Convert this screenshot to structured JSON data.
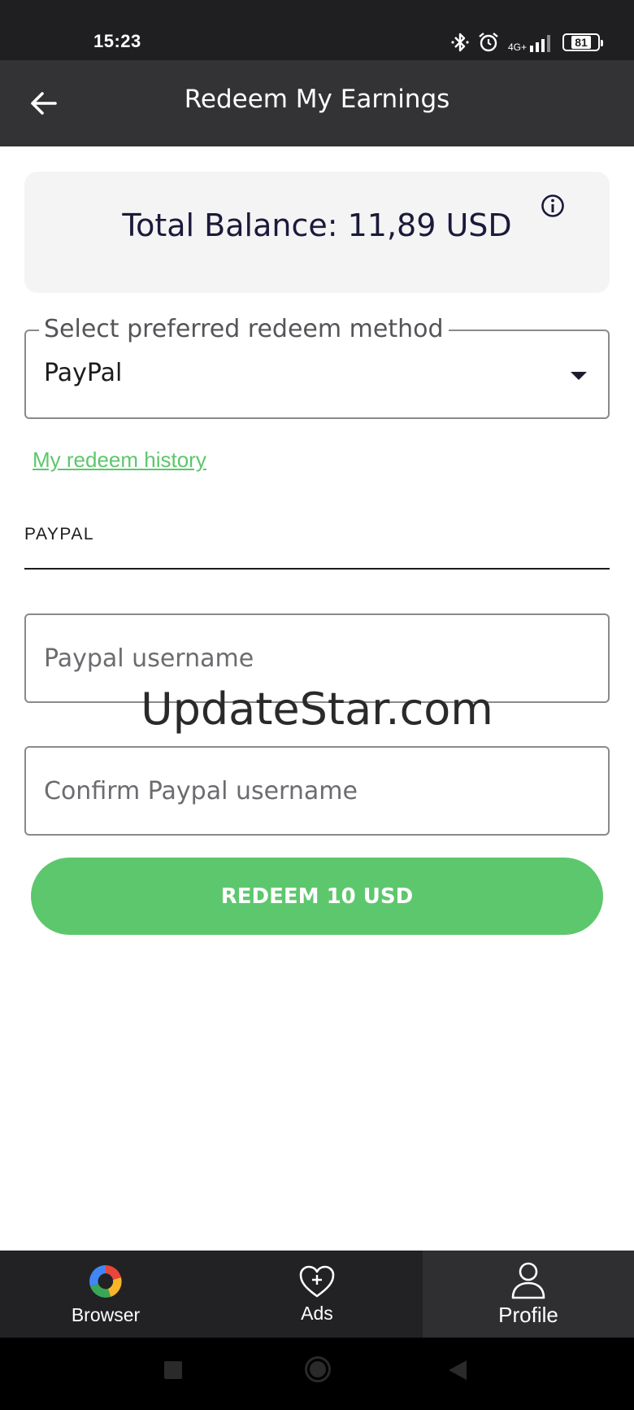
{
  "status_bar": {
    "time": "15:23",
    "network": "4G+",
    "battery": "81",
    "icons": [
      "bluetooth-icon",
      "alarm-icon",
      "signal-icon",
      "battery-icon"
    ]
  },
  "app_bar": {
    "title": "Redeem My Earnings",
    "back_icon": "arrow-left-icon"
  },
  "balance": {
    "text": "Total Balance: 11,89 USD",
    "info_icon": "info-icon"
  },
  "redeem_method": {
    "label": "Select preferred redeem method",
    "value": "PayPal"
  },
  "history_link": "My redeem history",
  "section": {
    "tab_label": "PAYPAL"
  },
  "form": {
    "username_placeholder": "Paypal username",
    "username_value": "",
    "confirm_placeholder": "Confirm Paypal username",
    "confirm_value": "",
    "submit_label": "REDEEM 10 USD"
  },
  "watermark": "UpdateStar.com",
  "bottom_nav": {
    "items": [
      {
        "label": "Browser",
        "icon": "browser-logo-icon",
        "active": false
      },
      {
        "label": "Ads",
        "icon": "heart-plus-icon",
        "active": false
      },
      {
        "label": "Profile",
        "icon": "person-icon",
        "active": true
      }
    ]
  },
  "colors": {
    "accent_green": "#5dc76d",
    "app_bar": "#333335",
    "status_bar": "#1f1f22",
    "nav_bar": "#222224",
    "balance_text": "#1b1a3a"
  }
}
